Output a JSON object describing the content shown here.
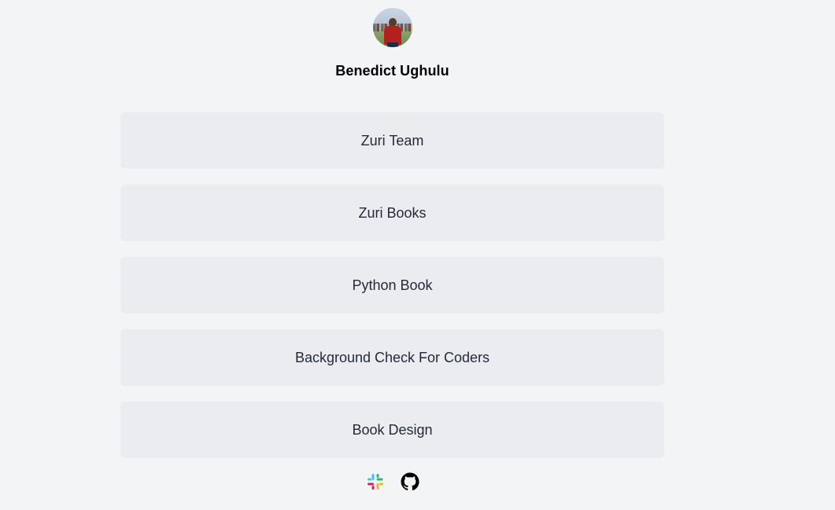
{
  "profile": {
    "name": "Benedict Ughulu",
    "avatar_alt": "profile photo"
  },
  "links": [
    {
      "label": "Zuri Team"
    },
    {
      "label": "Zuri Books"
    },
    {
      "label": "Python Book"
    },
    {
      "label": "Background Check For Coders"
    },
    {
      "label": "Book Design"
    }
  ],
  "socials": [
    {
      "icon": "slack-icon"
    },
    {
      "icon": "github-icon"
    }
  ],
  "colors": {
    "background": "#f3f4f6",
    "link_background": "#ebecef",
    "text": "#1f2937"
  }
}
